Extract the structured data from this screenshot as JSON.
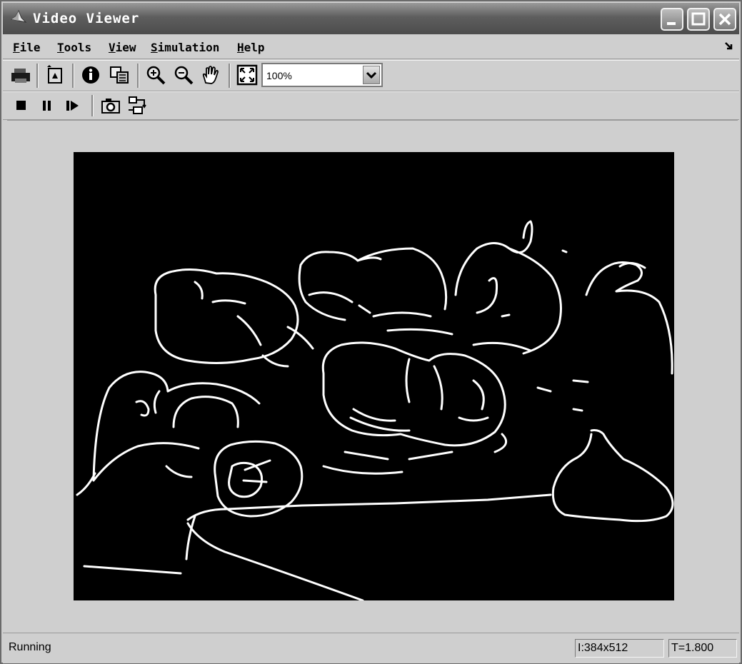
{
  "window": {
    "title": "Video Viewer"
  },
  "menu": {
    "items": [
      {
        "accel": "F",
        "rest": "ile"
      },
      {
        "accel": "T",
        "rest": "ools"
      },
      {
        "accel": "V",
        "rest": "iew"
      },
      {
        "accel": "S",
        "rest": "imulation"
      },
      {
        "accel": "H",
        "rest": "elp"
      }
    ]
  },
  "toolbar": {
    "zoom": {
      "value": "100%"
    }
  },
  "status": {
    "state": "Running",
    "dimensions": "I:384x512",
    "time": "T=1.800"
  }
}
